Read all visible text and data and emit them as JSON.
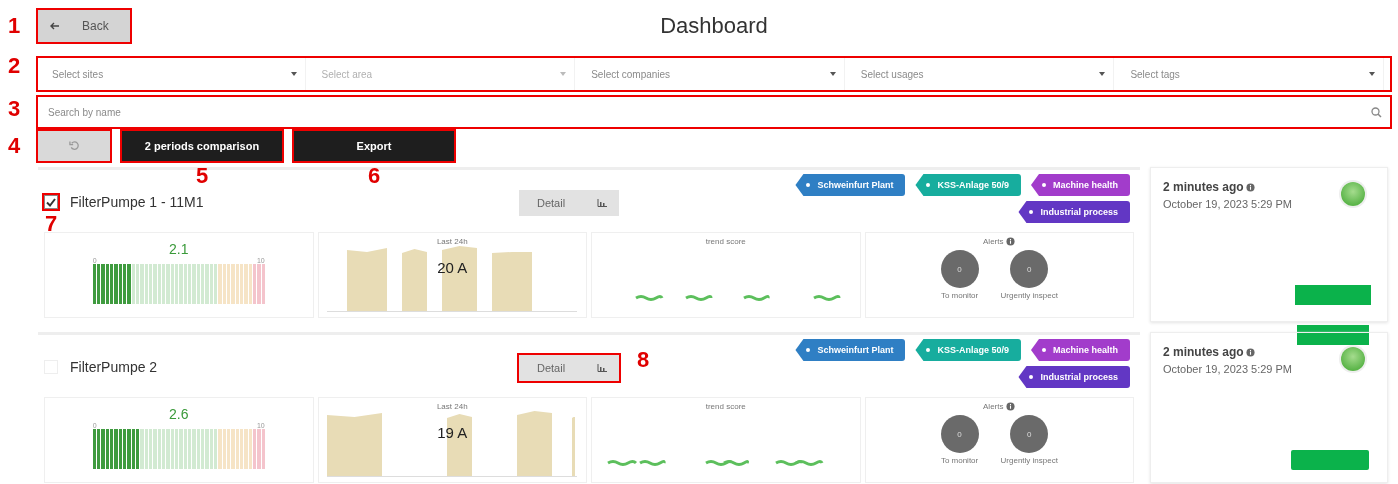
{
  "header": {
    "back": {
      "label": "Back",
      "callout": "1"
    },
    "title": "Dashboard"
  },
  "filters": {
    "callout": "2",
    "selects": [
      {
        "placeholder": "Select sites",
        "disabled": false
      },
      {
        "placeholder": "Select area",
        "disabled": true
      },
      {
        "placeholder": "Select companies",
        "disabled": false
      },
      {
        "placeholder": "Select usages",
        "disabled": false
      },
      {
        "placeholder": "Select tags",
        "disabled": false
      }
    ]
  },
  "search": {
    "placeholder": "Search by name",
    "callout": "3"
  },
  "actions": [
    {
      "kind": "reset",
      "callout": "4"
    },
    {
      "kind": "text",
      "label": "2 periods comparison",
      "callout": "5"
    },
    {
      "kind": "text",
      "label": "Export",
      "callout": "6"
    }
  ],
  "devices": [
    {
      "name": "FilterPumpe 1 - 11M1",
      "checked": true,
      "checkbox_callout": "7",
      "detail": {
        "label": "Detail"
      },
      "gauge": {
        "value": "2.1",
        "min": "0",
        "max": "10",
        "level": 0.21
      },
      "last24": {
        "title": "Last 24h",
        "reading": "20 A"
      },
      "trend": {
        "title": "trend score"
      },
      "alerts": {
        "title": "Alerts",
        "items": [
          {
            "count": "0",
            "label": "To monitor"
          },
          {
            "count": "0",
            "label": "Urgently inspect"
          }
        ]
      },
      "tags": [
        {
          "label": "Schweinfurt Plant",
          "color": "#2f7fc4"
        },
        {
          "label": "KSS-Anlage 50/9",
          "color": "#17ad9e"
        },
        {
          "label": "Machine health",
          "color": "#a23ccb"
        },
        {
          "label": "Industrial process",
          "color": "#6237c4"
        }
      ],
      "side": {
        "ago": "2 minutes ago",
        "date": "October 19, 2023 5:29 PM",
        "online": true
      }
    },
    {
      "name": "FilterPumpe 2",
      "checked": false,
      "detail": {
        "label": "Detail",
        "callout": "8"
      },
      "gauge": {
        "value": "2.6",
        "min": "0",
        "max": "10",
        "level": 0.26
      },
      "last24": {
        "title": "Last 24h",
        "reading": "19 A"
      },
      "trend": {
        "title": "trend score"
      },
      "alerts": {
        "title": "Alerts",
        "items": [
          {
            "count": "0",
            "label": "To monitor"
          },
          {
            "count": "0",
            "label": "Urgently inspect"
          }
        ]
      },
      "tags": [
        {
          "label": "Schweinfurt Plant",
          "color": "#2f7fc4"
        },
        {
          "label": "KSS-Anlage 50/9",
          "color": "#17ad9e"
        },
        {
          "label": "Machine health",
          "color": "#a23ccb"
        },
        {
          "label": "Industrial process",
          "color": "#6237c4"
        }
      ],
      "side": {
        "ago": "2 minutes ago",
        "date": "October 19, 2023 5:29 PM",
        "online": true
      }
    }
  ]
}
